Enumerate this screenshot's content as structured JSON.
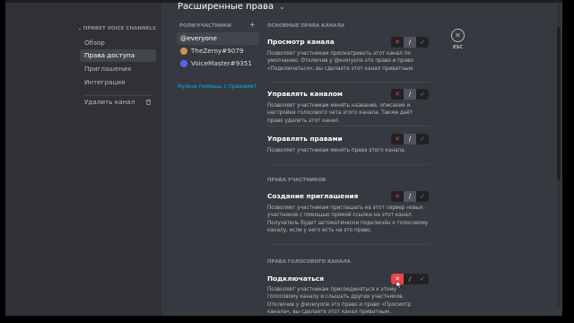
{
  "sidebar": {
    "header": "ПРИВЕТ VOICE CHANNELS",
    "items": [
      {
        "label": "Обзор"
      },
      {
        "label": "Права доступа"
      },
      {
        "label": "Приглашения"
      },
      {
        "label": "Интеграция"
      }
    ],
    "delete_label": "Удалить канал"
  },
  "page": {
    "title": "Расширенные права"
  },
  "roles": {
    "header": "РОЛИ/УЧАСТНИКИ",
    "add": "+",
    "items": [
      {
        "label": "@everyone"
      },
      {
        "label": "TheZeroy#9079"
      },
      {
        "label": "VoiceMaster#9351"
      }
    ],
    "help_link": "Нужна помощь с правами?"
  },
  "sections": {
    "channel": "ОСНОВНЫЕ ПРАВА КАНАЛА",
    "members": "ПРАВА УЧАСТНИКОВ",
    "voice": "ПРАВА ГОЛОСОВОГО КАНАЛА"
  },
  "permissions": [
    {
      "title": "Просмотр канала",
      "desc": "Позволяет участникам просматривать этот канал по умолчанию. Отключив у @everyone это право и право «Подключаться», вы сделаете этот канал приватным.",
      "state": "neutral"
    },
    {
      "title": "Управлять каналом",
      "desc": "Позволяет участникам менять название, описание и настройки голосового чата этого канала. Также даёт право удалить этот канал.",
      "state": "neutral"
    },
    {
      "title": "Управлять правами",
      "desc": "Позволяет участникам менять права этого канала.",
      "state": "neutral"
    },
    {
      "title": "Создание приглашения",
      "desc": "Позволяет участникам приглашать на этот сервер новых участников с помощью прямой ссылки на этот канал. Получатель будет автоматически подключён к голосовому каналу, если у него есть на это право.",
      "state": "neutral"
    },
    {
      "title": "Подключаться",
      "desc": "Позволяет участникам присоединяться к этому голосовому каналу и слышать других участников. Отключив у @everyone это право и право «Просмотр канала», вы сделаете этот канал приватным.",
      "state": "denied"
    }
  ],
  "toggle": {
    "deny": "✕",
    "neutral": "/",
    "allow": "✓"
  },
  "esc": {
    "icon": "✕",
    "label": "ESC"
  },
  "colors": {
    "accent_link": "#00aff4",
    "deny": "#ed4245",
    "allow": "#3ba55d",
    "sidebar_bg": "#2f3136",
    "content_bg": "#36393f"
  },
  "icons": {
    "speaker": "speaker-icon",
    "trash": "trash-icon",
    "close": "close-icon",
    "chevron": "chevron-down-icon",
    "plus": "plus-icon"
  }
}
